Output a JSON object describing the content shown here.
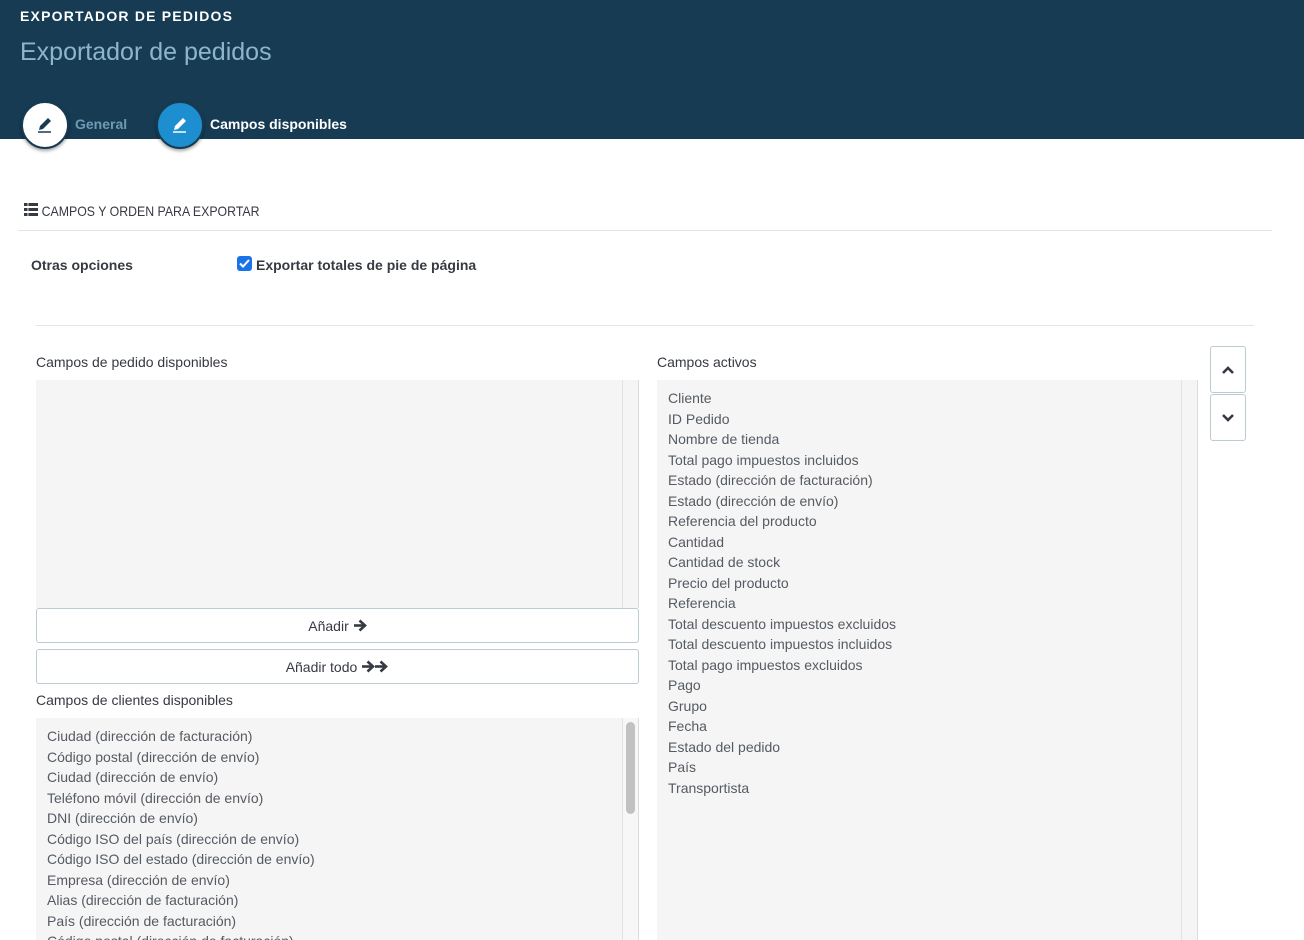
{
  "header": {
    "breadcrumb": "EXPORTADOR DE PEDIDOS",
    "title": "Exportador de pedidos",
    "tabs": [
      {
        "label": "General",
        "icon": "pencil-icon",
        "active": false
      },
      {
        "label": "Campos disponibles",
        "icon": "pencil-icon",
        "active": true
      }
    ]
  },
  "section": {
    "title": "CAMPOS Y ORDEN PARA EXPORTAR",
    "icon": "list-icon"
  },
  "options": {
    "label": "Otras opciones",
    "checkbox_label": "Exportar totales de pie de página",
    "checkbox_checked": true
  },
  "available_order_fields": {
    "title": "Campos de pedido disponibles",
    "items": []
  },
  "buttons": {
    "add": "Añadir",
    "add_all": "Añadir todo"
  },
  "available_customer_fields": {
    "title": "Campos de clientes disponibles",
    "items": [
      "Ciudad (dirección de facturación)",
      "Código postal (dirección de envío)",
      "Ciudad (dirección de envío)",
      "Teléfono móvil (dirección de envío)",
      "DNI (dirección de envío)",
      "Código ISO del país (dirección de envío)",
      "Código ISO del estado (dirección de envío)",
      "Empresa (dirección de envío)",
      "Alias (dirección de facturación)",
      "País (dirección de facturación)",
      "Código postal (dirección de facturación)"
    ]
  },
  "active_fields": {
    "title": "Campos activos",
    "items": [
      "Cliente",
      "ID Pedido",
      "Nombre de tienda",
      "Total pago impuestos incluidos",
      "Estado (dirección de facturación)",
      "Estado (dirección de envío)",
      "Referencia del producto",
      "Cantidad",
      "Cantidad de stock",
      "Precio del producto",
      "Referencia",
      "Total descuento impuestos excluidos",
      "Total descuento impuestos incluidos",
      "Total pago impuestos excluidos",
      "Pago",
      "Grupo",
      "Fecha",
      "Estado del pedido",
      "País",
      "Transportista"
    ]
  },
  "colors": {
    "header_bg": "#163b53",
    "accent": "#1d8fd0",
    "title_text": "#8eb6cb"
  }
}
